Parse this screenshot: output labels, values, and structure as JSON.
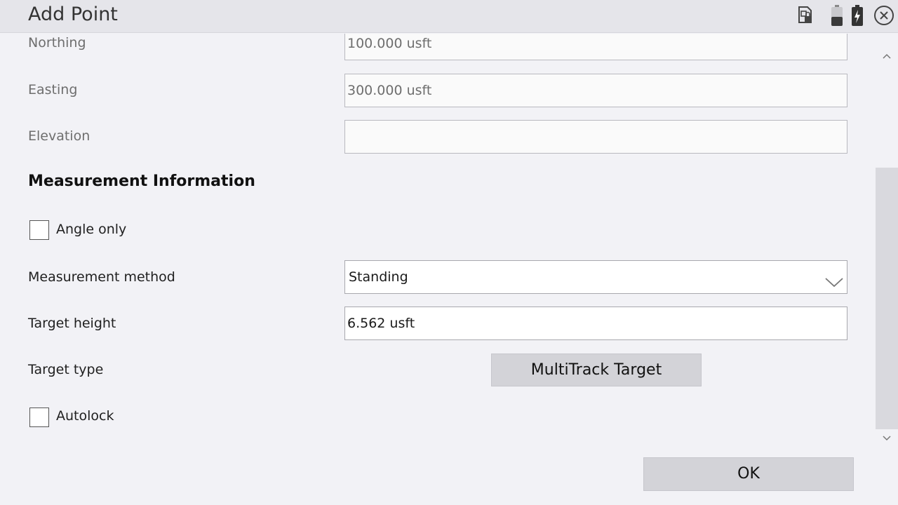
{
  "window": {
    "title": "Add Point"
  },
  "status_icons": [
    "sim-lock-icon",
    "battery-low-icon",
    "battery-charging-icon",
    "close-icon"
  ],
  "fields": {
    "northing": {
      "label": "Northing",
      "value": "100.000 usft"
    },
    "easting": {
      "label": "Easting",
      "value": "300.000 usft"
    },
    "elevation": {
      "label": "Elevation",
      "value": ""
    }
  },
  "measurement": {
    "heading": "Measurement Information",
    "angle_only": {
      "label": "Angle only",
      "checked": false
    },
    "method": {
      "label": "Measurement method",
      "value": "Standing"
    },
    "target_height": {
      "label": "Target height",
      "value": "6.562 usft"
    },
    "target_type": {
      "label": "Target type",
      "value": "MultiTrack Target"
    },
    "autolock": {
      "label": "Autolock",
      "checked": false
    }
  },
  "footer": {
    "ok_label": "OK"
  },
  "colors": {
    "titlebar": "#e5e5ea",
    "background": "#f2f2f6",
    "button": "#d3d3d8"
  }
}
